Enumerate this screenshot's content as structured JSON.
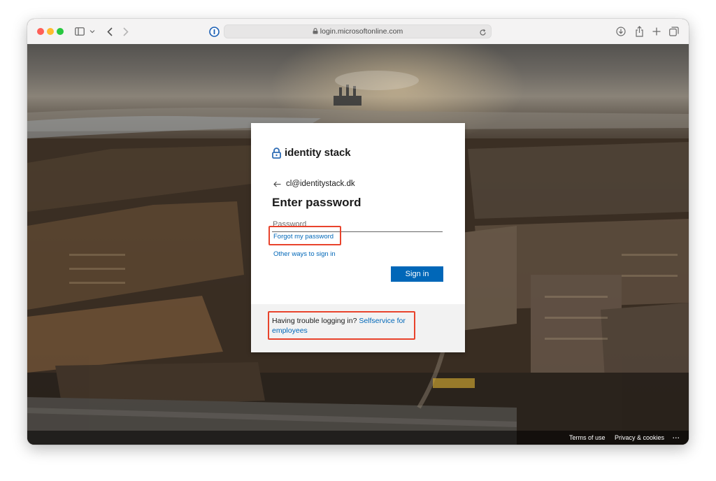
{
  "browser": {
    "url": "login.microsoftonline.com",
    "traffic_lights": {
      "close": "#ff5f57",
      "minimize": "#febc2e",
      "zoom": "#28c840"
    }
  },
  "login": {
    "brand_name": "identity stack",
    "email": "cl@identitystack.dk",
    "heading": "Enter password",
    "password_placeholder": "Password",
    "password_value": "",
    "forgot_link": "Forgot my password",
    "other_ways_link": "Other ways to sign in",
    "signin_button": "Sign in",
    "trouble_text": "Having trouble logging in?",
    "selfservice_link": "Selfservice for employees"
  },
  "footer": {
    "terms": "Terms of use",
    "privacy": "Privacy & cookies",
    "more": "..."
  },
  "colors": {
    "accent": "#0067b8",
    "highlight_box": "#e8432c"
  }
}
